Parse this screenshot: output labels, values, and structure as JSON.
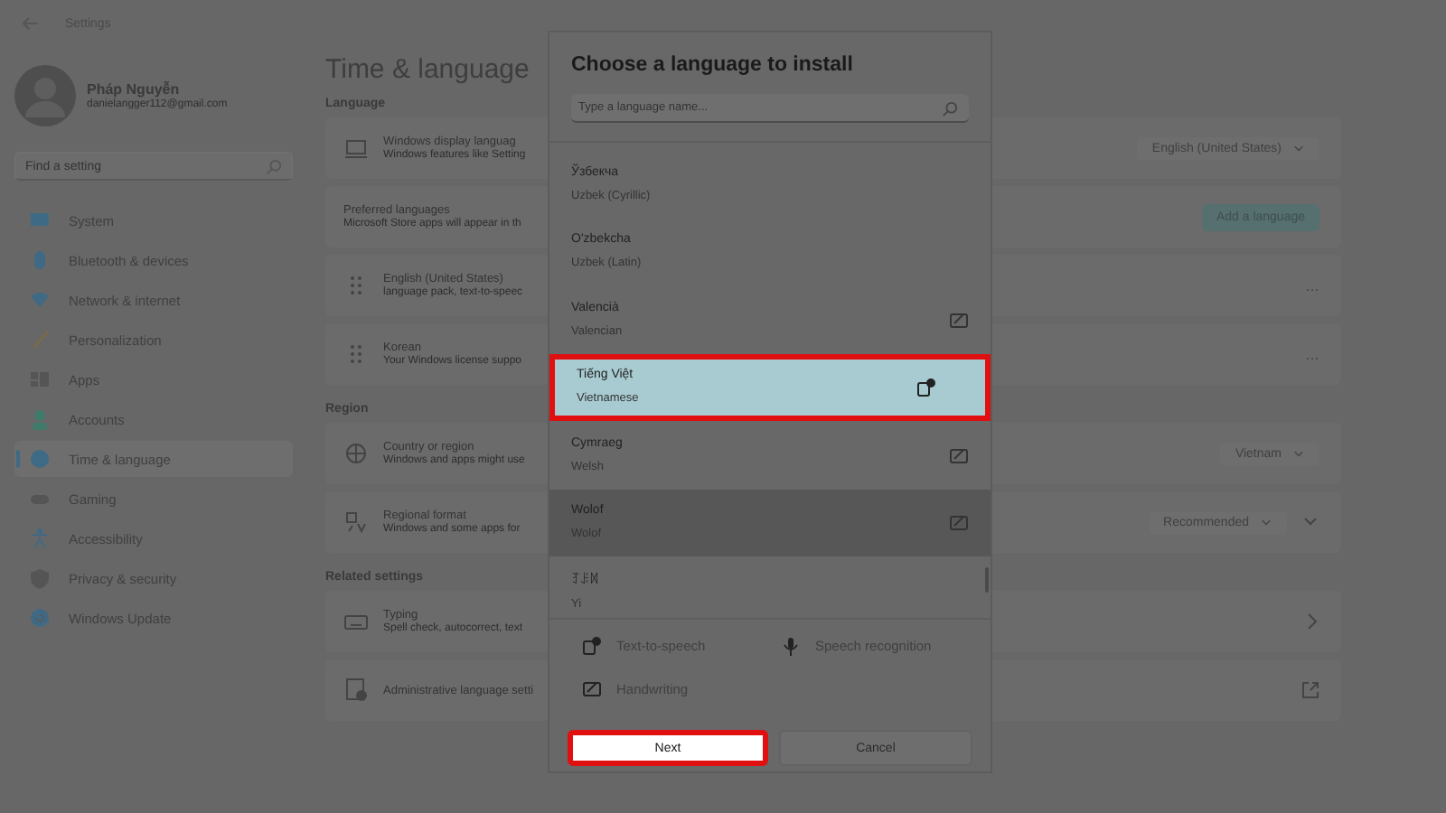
{
  "window": {
    "title": "Settings"
  },
  "user": {
    "name": "Pháp Nguyễn",
    "email": "danielangger112@gmail.com"
  },
  "search": {
    "placeholder": "Find a setting"
  },
  "sidebar": {
    "items": [
      {
        "label": "System",
        "selected": false
      },
      {
        "label": "Bluetooth & devices",
        "selected": false
      },
      {
        "label": "Network & internet",
        "selected": false
      },
      {
        "label": "Personalization",
        "selected": false
      },
      {
        "label": "Apps",
        "selected": false
      },
      {
        "label": "Accounts",
        "selected": false
      },
      {
        "label": "Time & language",
        "selected": true
      },
      {
        "label": "Gaming",
        "selected": false
      },
      {
        "label": "Accessibility",
        "selected": false
      },
      {
        "label": "Privacy & security",
        "selected": false
      },
      {
        "label": "Windows Update",
        "selected": false
      }
    ]
  },
  "page": {
    "title": "Time & language",
    "sections": [
      {
        "heading": "Language",
        "cards": [
          {
            "kind": "dropdown",
            "title": "Windows display languag",
            "subtitle": "Windows features like Setting",
            "value": "English (United States)"
          },
          {
            "kind": "button",
            "title": "Preferred languages",
            "subtitle": "Microsoft Store apps will appear in th",
            "value": "Add a language"
          },
          {
            "kind": "more",
            "title": "English (United States)",
            "subtitle": "language pack, text-to-speec",
            "value": "…"
          },
          {
            "kind": "more",
            "title": "Korean",
            "subtitle": "Your Windows license suppo",
            "value": "…"
          }
        ]
      },
      {
        "heading": "Region",
        "cards": [
          {
            "kind": "dropdown",
            "title": "Country or region",
            "subtitle": "Windows and apps might use",
            "value": "Vietnam"
          },
          {
            "kind": "expand",
            "title": "Regional format",
            "subtitle": "Windows and some apps for",
            "value": "Recommended"
          }
        ]
      },
      {
        "heading": "Related settings",
        "cards": [
          {
            "kind": "link",
            "title": "Typing",
            "subtitle": "Spell check, autocorrect, text"
          },
          {
            "kind": "external",
            "title": "Administrative language setti"
          }
        ]
      }
    ]
  },
  "dialog": {
    "title": "Choose a language to install",
    "search_placeholder": "Type a language name...",
    "languages": [
      {
        "native": "Ўзбекча",
        "english": "Uzbek (Cyrillic)",
        "kind": "plain",
        "selected": false,
        "hovered": false,
        "highlighted": false
      },
      {
        "native": "O'zbekcha",
        "english": "Uzbek (Latin)",
        "kind": "plain",
        "selected": false,
        "hovered": false,
        "highlighted": false
      },
      {
        "native": "Valencià",
        "english": "Valencian",
        "kind": "handwriting",
        "selected": false,
        "hovered": false,
        "highlighted": false
      },
      {
        "native": "Tiếng Việt",
        "english": "Vietnamese",
        "kind": "speech",
        "selected": true,
        "hovered": false,
        "highlighted": true
      },
      {
        "native": "Cymraeg",
        "english": "Welsh",
        "kind": "handwriting",
        "selected": false,
        "hovered": false,
        "highlighted": false
      },
      {
        "native": "Wolof",
        "english": "Wolof",
        "kind": "handwriting",
        "selected": false,
        "hovered": true,
        "highlighted": false
      },
      {
        "native": "ꆈꌠꉙ",
        "english": "Yi",
        "kind": "plain",
        "selected": false,
        "hovered": false,
        "highlighted": false
      }
    ],
    "legend": [
      {
        "label": "Text-to-speech"
      },
      {
        "label": "Speech recognition"
      },
      {
        "label": "Handwriting"
      }
    ],
    "buttons": [
      {
        "label": "Next",
        "primary": true,
        "highlighted": true
      },
      {
        "label": "Cancel",
        "primary": false,
        "highlighted": false
      }
    ]
  }
}
